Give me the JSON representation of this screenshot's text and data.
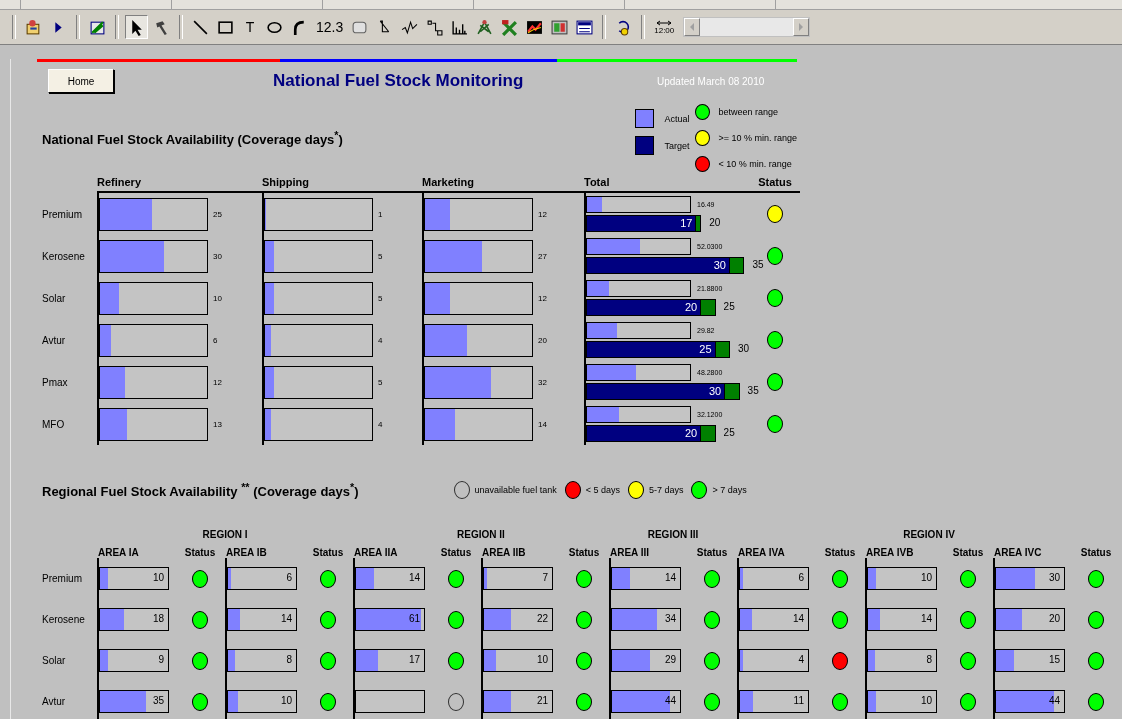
{
  "toolbar": {
    "groups": [
      [
        {
          "kind": "wizard",
          "selected": false
        },
        {
          "kind": "play",
          "selected": false
        }
      ],
      [
        {
          "kind": "edit",
          "selected": false
        }
      ],
      [
        {
          "kind": "pointer",
          "selected": true
        },
        {
          "kind": "hammer",
          "selected": false
        }
      ],
      [
        {
          "kind": "line",
          "selected": false
        },
        {
          "kind": "rect",
          "selected": false
        },
        {
          "kind": "text",
          "label": "T",
          "selected": false
        },
        {
          "kind": "ellipse",
          "selected": false
        },
        {
          "kind": "arc",
          "selected": false
        },
        {
          "kind": "text",
          "label": "12.3",
          "selected": false
        },
        {
          "kind": "roundrect",
          "selected": false
        },
        {
          "kind": "connector",
          "selected": false
        },
        {
          "kind": "sparkline",
          "selected": false
        },
        {
          "kind": "step",
          "selected": false
        },
        {
          "kind": "bars",
          "selected": false
        },
        {
          "kind": "plant",
          "selected": false
        },
        {
          "kind": "tools",
          "selected": false
        },
        {
          "kind": "trend",
          "selected": false
        },
        {
          "kind": "display",
          "selected": false
        },
        {
          "kind": "panel",
          "selected": false
        }
      ],
      [
        {
          "kind": "timer",
          "selected": false
        }
      ],
      [
        {
          "kind": "interval",
          "label": "12:00",
          "selected": false
        }
      ]
    ]
  },
  "header": {
    "home_button": "Home",
    "title": "National Fuel Stock Monitoring",
    "updated": "Updated March 08 2010"
  },
  "national": {
    "heading": "National Fuel Stock Availability (Coverage days$^{*}$)",
    "legend_bars": [
      {
        "label": "Actual",
        "color": "#8080ff"
      },
      {
        "label": "Target",
        "color": "#000080"
      }
    ],
    "legend_status": [
      {
        "label": "between range",
        "color": "#00ff00"
      },
      {
        "label": ">= 10 % min. range",
        "color": "#ffff00"
      },
      {
        "label": "< 10 % min. range",
        "color": "#ff0000"
      }
    ],
    "columns": [
      "Refinery",
      "Shipping",
      "Marketing",
      "Total",
      "Status"
    ],
    "rows": [
      {
        "name": "Premium",
        "refinery": {
          "value": "25",
          "level": 0.49
        },
        "shipping": {
          "value": "1",
          "level": 0.01
        },
        "marketing": {
          "value": "12",
          "level": 0.23
        },
        "total": {
          "actual": {
            "value": "16.49",
            "level": 0.15
          },
          "target": {
            "value": "17",
            "level": 0.69
          },
          "limit": {
            "value": "20",
            "level": 0.72
          }
        },
        "color": "#ffff00"
      },
      {
        "name": "Kerosene",
        "refinery": {
          "value": "30",
          "level": 0.6
        },
        "shipping": {
          "value": "5",
          "level": 0.08
        },
        "marketing": {
          "value": "27",
          "level": 0.53
        },
        "total": {
          "actual": {
            "value": "52.0300",
            "level": 0.51
          },
          "target": {
            "value": "30",
            "level": 0.9
          },
          "limit": {
            "value": "35",
            "level": 0.99
          }
        },
        "color": "#00ff00"
      },
      {
        "name": "Solar",
        "refinery": {
          "value": "10",
          "level": 0.18
        },
        "shipping": {
          "value": "5",
          "level": 0.08
        },
        "marketing": {
          "value": "12",
          "level": 0.23
        },
        "total": {
          "actual": {
            "value": "21.8800",
            "level": 0.21
          },
          "target": {
            "value": "20",
            "level": 0.72
          },
          "limit": {
            "value": "25",
            "level": 0.81
          }
        },
        "color": "#00ff00"
      },
      {
        "name": "Avtur",
        "refinery": {
          "value": "6",
          "level": 0.1
        },
        "shipping": {
          "value": "4",
          "level": 0.06
        },
        "marketing": {
          "value": "20",
          "level": 0.39
        },
        "total": {
          "actual": {
            "value": "29.82",
            "level": 0.29
          },
          "target": {
            "value": "25",
            "level": 0.81
          },
          "limit": {
            "value": "30",
            "level": 0.9
          }
        },
        "color": "#00ff00"
      },
      {
        "name": "Pmax",
        "refinery": {
          "value": "12",
          "level": 0.23
        },
        "shipping": {
          "value": "5",
          "level": 0.08
        },
        "marketing": {
          "value": "32",
          "level": 0.62
        },
        "total": {
          "actual": {
            "value": "48.2800",
            "level": 0.48
          },
          "target": {
            "value": "30",
            "level": 0.87
          },
          "limit": {
            "value": "35",
            "level": 0.96
          }
        },
        "color": "#00ff00"
      },
      {
        "name": "MFO",
        "refinery": {
          "value": "13",
          "level": 0.25
        },
        "shipping": {
          "value": "4",
          "level": 0.06
        },
        "marketing": {
          "value": "14",
          "level": 0.28
        },
        "total": {
          "actual": {
            "value": "32.1200",
            "level": 0.31
          },
          "target": {
            "value": "20",
            "level": 0.72
          },
          "limit": {
            "value": "25",
            "level": 0.81
          }
        },
        "color": "#00ff00"
      }
    ]
  },
  "regional": {
    "heading": "Regional Fuel Stock Availability $^{**}$ (Coverage days$^{*}$)",
    "legend": [
      {
        "kind": "hollow",
        "label": "unavailable fuel tank"
      },
      {
        "kind": "filled",
        "label": "< 5 days",
        "color": "#ff0000"
      },
      {
        "kind": "filled",
        "label": "5-7 days",
        "color": "#ffff00"
      },
      {
        "kind": "filled",
        "label": "> 7 days",
        "color": "#00ff00"
      }
    ],
    "row_labels": [
      "Premium",
      "Kerosene",
      "Solar",
      "Avtur"
    ],
    "regions": [
      {
        "name": "REGION I",
        "areas": [
          {
            "name": "AREA IA",
            "status_label": "Status",
            "cells": [
              {
                "kind": "stock",
                "value": "10",
                "level": 0.12,
                "color": "#00ff00"
              },
              {
                "kind": "stock",
                "value": "18",
                "level": 0.35,
                "color": "#00ff00"
              },
              {
                "kind": "stock",
                "value": "9",
                "level": 0.12,
                "color": "#00ff00"
              },
              {
                "kind": "stock",
                "value": "35",
                "level": 0.68,
                "color": "#00ff00"
              }
            ]
          },
          {
            "name": "AREA IB",
            "status_label": "Status",
            "cells": [
              {
                "kind": "stock",
                "value": "6",
                "level": 0.04,
                "color": "#00ff00"
              },
              {
                "kind": "stock",
                "value": "14",
                "level": 0.18,
                "color": "#00ff00"
              },
              {
                "kind": "stock",
                "value": "8",
                "level": 0.1,
                "color": "#00ff00"
              },
              {
                "kind": "stock",
                "value": "10",
                "level": 0.15,
                "color": "#00ff00"
              }
            ]
          }
        ]
      },
      {
        "name": "REGION II",
        "areas": [
          {
            "name": "AREA IIA",
            "status_label": "Status",
            "cells": [
              {
                "kind": "stock",
                "value": "14",
                "level": 0.27,
                "color": "#00ff00"
              },
              {
                "kind": "stock",
                "value": "61",
                "level": 0.95,
                "color": "#00ff00"
              },
              {
                "kind": "stock",
                "value": "17",
                "level": 0.32,
                "color": "#00ff00"
              },
              {
                "kind": "unavailable"
              }
            ]
          },
          {
            "name": "AREA IIB",
            "status_label": "Status",
            "cells": [
              {
                "kind": "stock",
                "value": "7",
                "level": 0.05,
                "color": "#00ff00"
              },
              {
                "kind": "stock",
                "value": "22",
                "level": 0.4,
                "color": "#00ff00"
              },
              {
                "kind": "stock",
                "value": "10",
                "level": 0.17,
                "color": "#00ff00"
              },
              {
                "kind": "stock",
                "value": "21",
                "level": 0.4,
                "color": "#00ff00"
              }
            ]
          }
        ]
      },
      {
        "name": "REGION III",
        "areas": [
          {
            "name": "AREA III",
            "status_label": "Status",
            "cells": [
              {
                "kind": "stock",
                "value": "14",
                "level": 0.27,
                "color": "#00ff00"
              },
              {
                "kind": "stock",
                "value": "34",
                "level": 0.66,
                "color": "#00ff00"
              },
              {
                "kind": "stock",
                "value": "29",
                "level": 0.56,
                "color": "#00ff00"
              },
              {
                "kind": "stock",
                "value": "44",
                "level": 0.85,
                "color": "#00ff00"
              }
            ]
          }
        ]
      },
      {
        "name": "REGION IV",
        "areas": [
          {
            "name": "AREA IVA",
            "status_label": "Status",
            "cells": [
              {
                "kind": "stock",
                "value": "6",
                "level": 0.05,
                "color": "#00ff00"
              },
              {
                "kind": "stock",
                "value": "14",
                "level": 0.18,
                "color": "#00ff00"
              },
              {
                "kind": "stock",
                "value": "4",
                "level": 0.04,
                "color": "#ff0000"
              },
              {
                "kind": "stock",
                "value": "11",
                "level": 0.19,
                "color": "#00ff00"
              }
            ]
          },
          {
            "name": "AREA IVB",
            "status_label": "Status",
            "cells": [
              {
                "kind": "stock",
                "value": "10",
                "level": 0.12,
                "color": "#00ff00"
              },
              {
                "kind": "stock",
                "value": "14",
                "level": 0.18,
                "color": "#00ff00"
              },
              {
                "kind": "stock",
                "value": "8",
                "level": 0.1,
                "color": "#00ff00"
              },
              {
                "kind": "stock",
                "value": "10",
                "level": 0.12,
                "color": "#00ff00"
              }
            ]
          },
          {
            "name": "AREA IVC",
            "status_label": "Status",
            "cells": [
              {
                "kind": "stock",
                "value": "30",
                "level": 0.58,
                "color": "#00ff00"
              },
              {
                "kind": "stock",
                "value": "20",
                "level": 0.38,
                "color": "#00ff00"
              },
              {
                "kind": "stock",
                "value": "15",
                "level": 0.27,
                "color": "#00ff00"
              },
              {
                "kind": "stock",
                "value": "44",
                "level": 0.85,
                "color": "#00ff00"
              }
            ]
          }
        ]
      }
    ]
  }
}
